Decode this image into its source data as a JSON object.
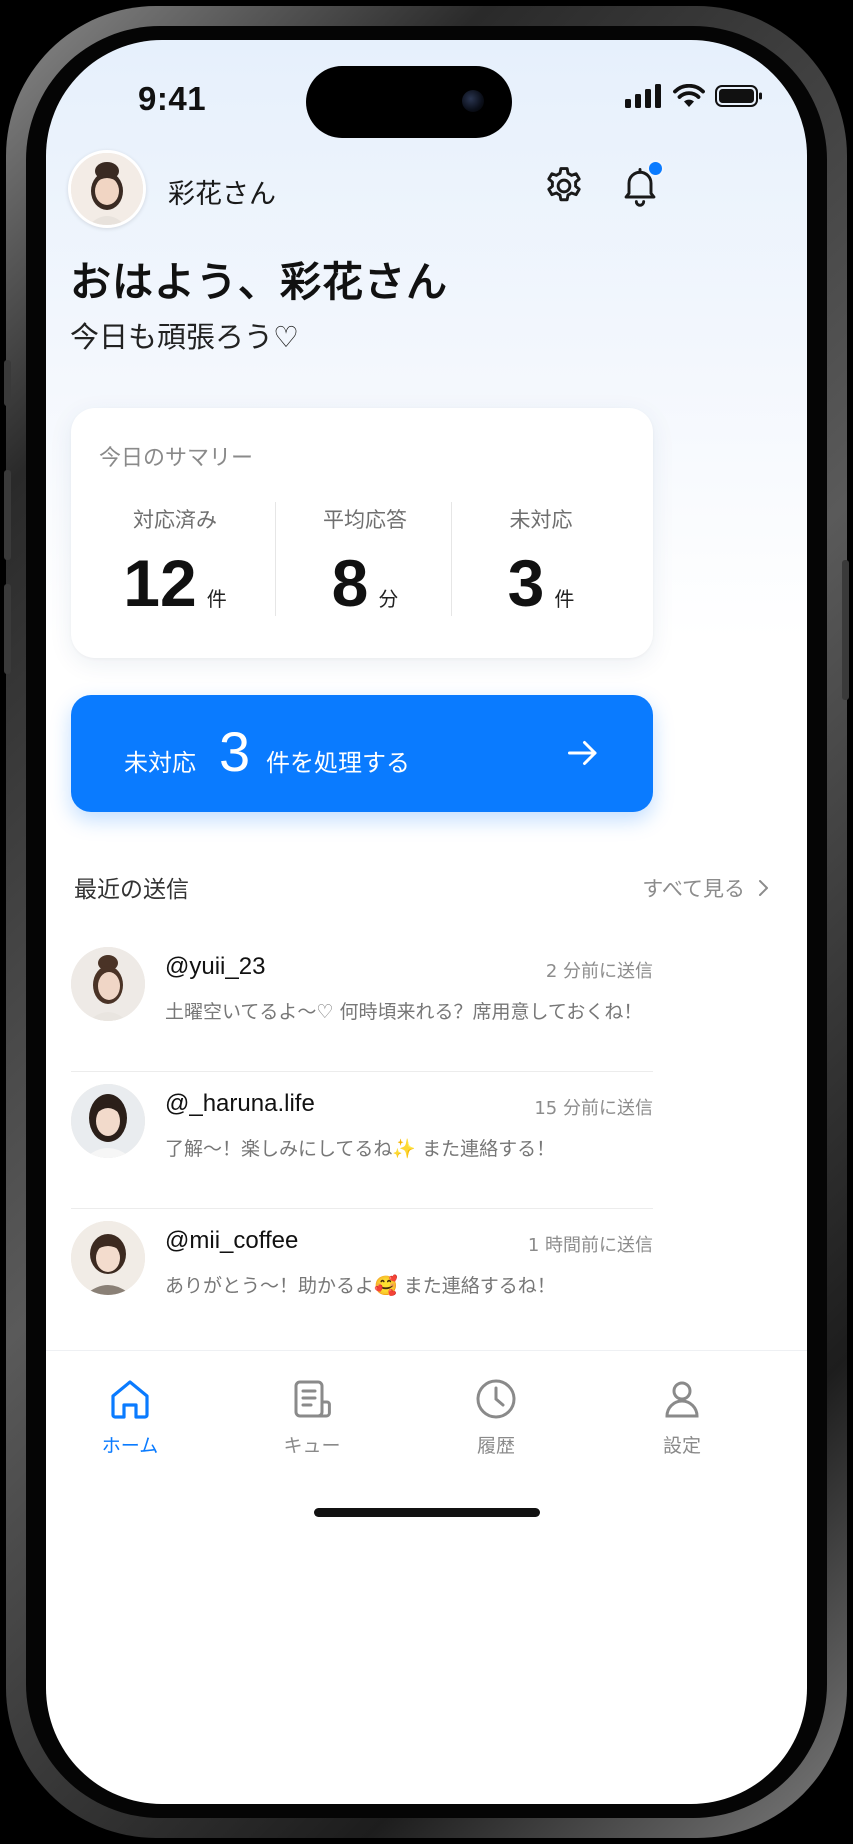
{
  "status_bar": {
    "time": "9:41"
  },
  "header": {
    "user_name": "彩花さん"
  },
  "greeting": {
    "title": "おはよう、彩花さん",
    "subtitle": "今日も頑張ろう♡"
  },
  "summary": {
    "title": "今日のサマリー",
    "stats": [
      {
        "label": "対応済み",
        "value": "12",
        "unit": "件"
      },
      {
        "label": "平均応答",
        "value": "8",
        "unit": "分"
      },
      {
        "label": "未対応",
        "value": "3",
        "unit": "件"
      }
    ]
  },
  "cta": {
    "prefix": "未対応",
    "count": "3",
    "suffix": "件を処理する"
  },
  "recent": {
    "title": "最近の送信",
    "see_all": "すべて見る",
    "items": [
      {
        "handle": "@yuii_23",
        "time": "2 分前に送信",
        "text": "土曜空いてるよ〜♡ 何時頃来れる？席用意しておくね！"
      },
      {
        "handle": "@_haruna.life",
        "time": "15 分前に送信",
        "text": "了解〜！楽しみにしてるね✨ また連絡する！"
      },
      {
        "handle": "@mii_coffee",
        "time": "1 時間前に送信",
        "text": "ありがとう〜！助かるよ🥰 また連絡するね！"
      }
    ]
  },
  "tabs": [
    {
      "label": "ホーム",
      "icon": "home-icon",
      "active": true
    },
    {
      "label": "キュー",
      "icon": "queue-icon",
      "active": false
    },
    {
      "label": "履歴",
      "icon": "history-icon",
      "active": false
    },
    {
      "label": "設定",
      "icon": "person-icon",
      "active": false
    }
  ],
  "colors": {
    "accent": "#0a7bff",
    "notification_dot": "#0a7bff"
  }
}
